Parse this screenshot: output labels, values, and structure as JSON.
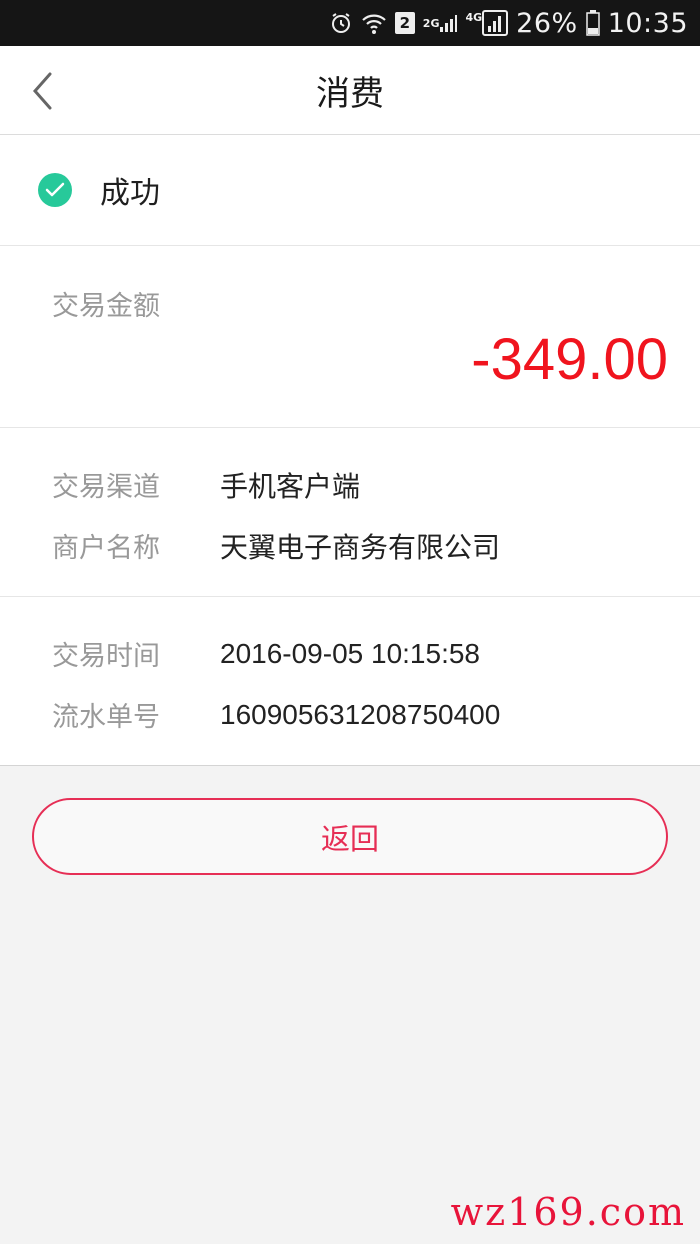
{
  "status_bar": {
    "sim": "2",
    "net_2g": "2G",
    "net_4g": "4G",
    "battery": "26%",
    "time": "10:35"
  },
  "header": {
    "title": "消费"
  },
  "status": {
    "text": "成功",
    "color": "#27c99a"
  },
  "amount": {
    "label": "交易金额",
    "value": "-349.00",
    "color": "#f0141e"
  },
  "details_1": [
    {
      "label": "交易渠道",
      "value": "手机客户端"
    },
    {
      "label": "商户名称",
      "value": "天翼电子商务有限公司"
    }
  ],
  "details_2": [
    {
      "label": "交易时间",
      "value": "2016-09-05 10:15:58"
    },
    {
      "label": "流水单号",
      "value": "160905631208750400"
    }
  ],
  "actions": {
    "return_label": "返回",
    "accent": "#e62e55"
  },
  "watermark": "wz169.com"
}
